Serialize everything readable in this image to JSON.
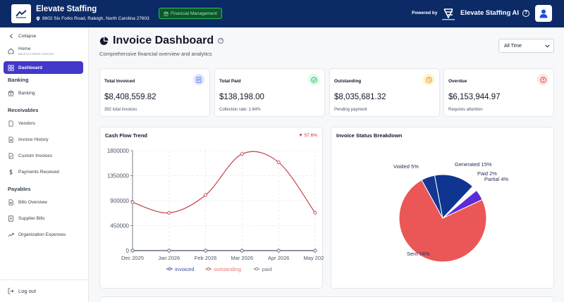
{
  "header": {
    "company": "Elevate Staffing",
    "address": "8602 Six Forks Road, Raleigh, North Carolina 27603",
    "badge": "Financial Management",
    "powered_by": "Powered by",
    "ai_brand": "Elevate Staffing AI"
  },
  "sidebar": {
    "collapse": "Collapse",
    "home": "Home",
    "home_sub": "Back to institute selection",
    "dashboard": "Dashboard",
    "sections": {
      "banking": "Banking",
      "receivables": "Receivables",
      "payables": "Payables"
    },
    "banking_items": [
      "Banking"
    ],
    "receivables_items": [
      "Vendors",
      "Invoice History",
      "Custom Invoices",
      "Payments Received"
    ],
    "payables_items": [
      "Bills Overview",
      "Supplier Bills",
      "Organization Expenses"
    ],
    "logout": "Log out"
  },
  "main": {
    "title": "Invoice Dashboard",
    "subtitle": "Comprehensive financial overview and analytics",
    "filter": "All Time"
  },
  "kpis": [
    {
      "label": "Total Invoiced",
      "value": "$8,408,559.82",
      "sub": "392 total invoices",
      "icon": "document-icon",
      "color": "#4f6bd8",
      "bg": "#e0e7ff"
    },
    {
      "label": "Total Paid",
      "value": "$138,198.00",
      "sub": "Collection rate: 1.64%",
      "icon": "check-circle-icon",
      "color": "#16a34a",
      "bg": "#dcfce7"
    },
    {
      "label": "Outstanding",
      "value": "$8,035,681.32",
      "sub": "Pending payment",
      "icon": "clock-icon",
      "color": "#d97706",
      "bg": "#fef3c7"
    },
    {
      "label": "Overdue",
      "value": "$6,153,944.97",
      "sub": "Requires attention",
      "icon": "alert-circle-icon",
      "color": "#dc2626",
      "bg": "#fee2e2"
    }
  ],
  "cash_flow": {
    "title": "Cash Flow Trend",
    "trend": "▼ 57.6%"
  },
  "status_panel": {
    "title": "Invoice Status Breakdown"
  },
  "chart_data": [
    {
      "type": "line",
      "title": "Cash Flow Trend",
      "x": [
        "Dec 2025",
        "Jan 2026",
        "Feb 2026",
        "Mar 2026",
        "Apr 2026",
        "May 2026"
      ],
      "yticks": [
        "0",
        "450000",
        "900000",
        "1350000",
        "1800000"
      ],
      "ylim": [
        0,
        1800000
      ],
      "grid": true,
      "legend": "bottom",
      "series": [
        {
          "name": "invoiced",
          "values": [
            0,
            0,
            0,
            0,
            0,
            0
          ],
          "color": "#1e3a8a"
        },
        {
          "name": "outstanding",
          "values": [
            870000,
            680000,
            1000000,
            1740000,
            1590000,
            680000
          ],
          "color": "#c2414b"
        },
        {
          "name": "paid",
          "values": [
            0,
            0,
            0,
            0,
            0,
            0
          ],
          "color": "#6b7280"
        }
      ]
    },
    {
      "type": "pie",
      "title": "Invoice Status Breakdown",
      "slices": [
        {
          "label": "Sent 74%",
          "value": 74,
          "color": "#eb5757"
        },
        {
          "label": "Voided 5%",
          "value": 5,
          "color": "#14378f"
        },
        {
          "label": "Generated 15%",
          "value": 15,
          "color": "#0f3591"
        },
        {
          "label": "Paid 2%",
          "value": 2,
          "color": "#ffffff"
        },
        {
          "label": "Partial 4%",
          "value": 4,
          "color": "#5b2bd9"
        }
      ]
    }
  ]
}
